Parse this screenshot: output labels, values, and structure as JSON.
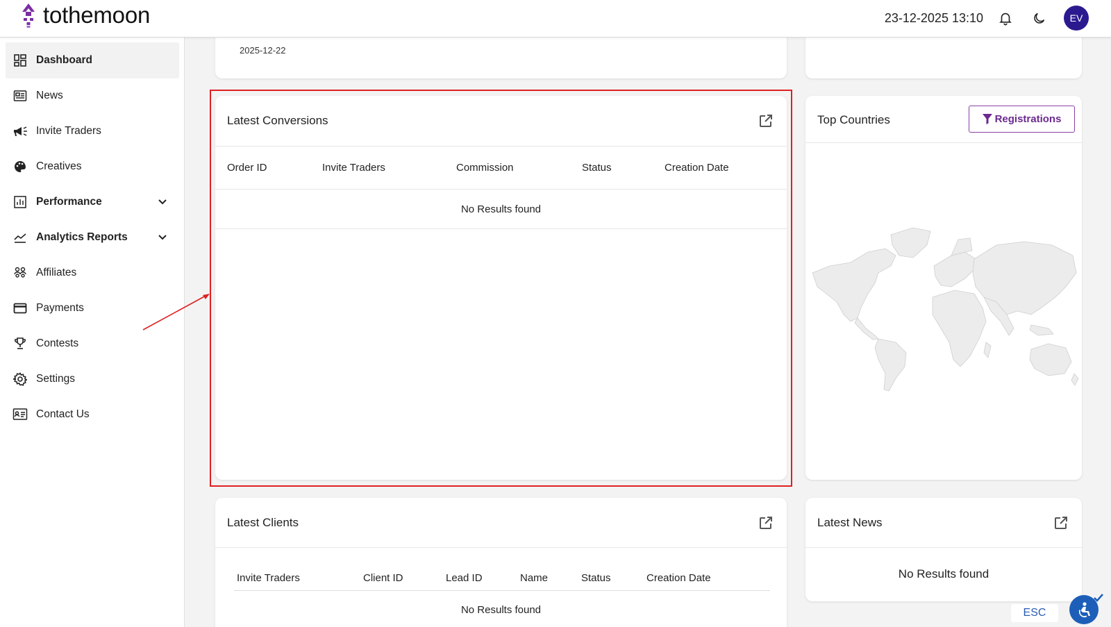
{
  "header": {
    "brand": "tothemoon",
    "datetime": "23-12-2025 13:10",
    "avatar_initials": "EV",
    "icons": [
      "bell-icon",
      "moon-icon"
    ]
  },
  "sidebar": {
    "items": [
      {
        "label": "Dashboard",
        "icon": "dashboard-icon",
        "active": true
      },
      {
        "label": "News",
        "icon": "news-icon"
      },
      {
        "label": "Invite Traders",
        "icon": "megaphone-icon"
      },
      {
        "label": "Creatives",
        "icon": "palette-icon"
      },
      {
        "label": "Performance",
        "icon": "bar-chart-icon",
        "expandable": true
      },
      {
        "label": "Analytics Reports",
        "icon": "line-chart-icon",
        "expandable": true
      },
      {
        "label": "Affiliates",
        "icon": "people-icon"
      },
      {
        "label": "Payments",
        "icon": "credit-card-icon"
      },
      {
        "label": "Contests",
        "icon": "trophy-icon"
      },
      {
        "label": "Settings",
        "icon": "gear-icon"
      },
      {
        "label": "Contact Us",
        "icon": "contact-card-icon"
      }
    ]
  },
  "top_card": {
    "date": "2025-12-22"
  },
  "latest_conversions": {
    "title": "Latest Conversions",
    "columns": [
      "Order ID",
      "Invite Traders",
      "Commission",
      "Status",
      "Creation Date"
    ],
    "empty_text": "No Results found"
  },
  "top_countries": {
    "title": "Top Countries",
    "filter_label": "Registrations"
  },
  "latest_clients": {
    "title": "Latest Clients",
    "columns": [
      "Invite Traders",
      "Client ID",
      "Lead ID",
      "Name",
      "Status",
      "Creation Date"
    ],
    "empty_text": "No Results found"
  },
  "latest_news": {
    "title": "Latest News",
    "empty_text": "No Results found"
  },
  "esc_label": "ESC",
  "colors": {
    "brand_purple": "#6b2a8f",
    "avatar_bg": "#2b1a8f",
    "highlight_red": "#e02020",
    "a11y_blue": "#1d5fb8"
  }
}
